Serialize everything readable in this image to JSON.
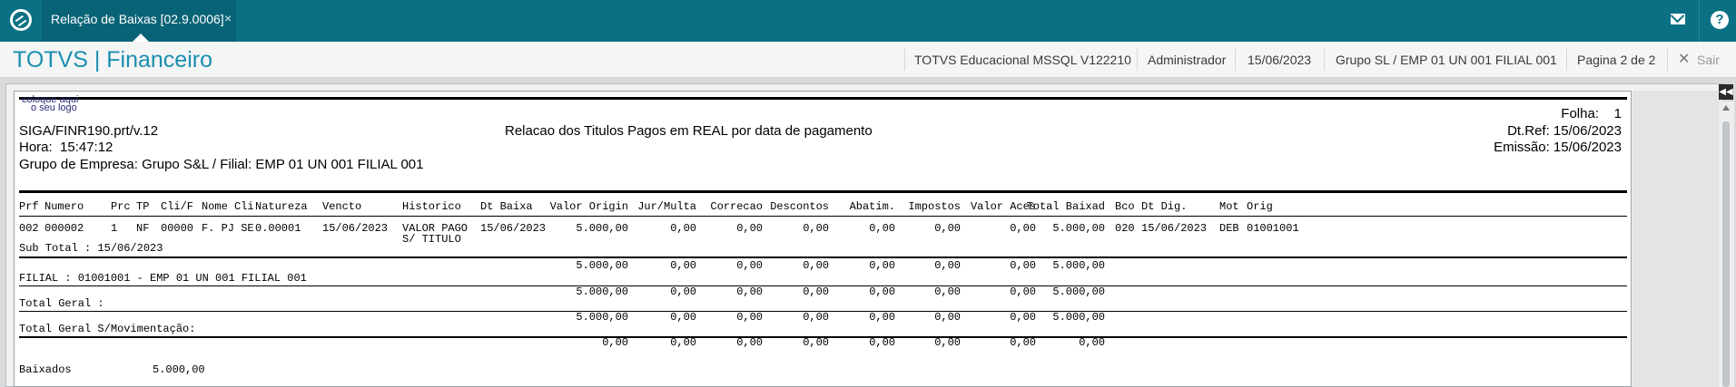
{
  "topbar": {
    "tab_title": "Relação de Baixas [02.9.0006]",
    "tab_close": "×",
    "help_symbol": "?"
  },
  "header": {
    "brand": "TOTVS | Financeiro",
    "environment": "TOTVS Educacional MSSQL V122210",
    "user": "Administrador",
    "date": "15/06/2023",
    "group": "Grupo SL / EMP 01 UN 001 FILIAL 001",
    "page": "Pagina 2 de 2",
    "exit_icon": "✕",
    "exit": "Sair"
  },
  "panel": {
    "collapse": "◀◀"
  },
  "report": {
    "logo_line1": "coloque aqui",
    "logo_line2": "o seu logo",
    "folha": "Folha:    1",
    "program": "SIGA/FINR190.prt/v.12",
    "title": "Relacao dos Titulos Pagos em REAL por data de pagamento",
    "dtref": "Dt.Ref: 15/06/2023",
    "hora": "Hora:  15:47:12",
    "emissao": "Emissão: 15/06/2023",
    "grupo": "Grupo de Empresa: Grupo S&L / Filial: EMP 01 UN 001 FILIAL 001",
    "columns": {
      "prf": "Prf",
      "numero": "Numero",
      "prc": "Prc",
      "tp": "TP",
      "clif": "Cli/F",
      "nomecli": "Nome Cli",
      "natureza": "Natureza",
      "vencto": "Vencto",
      "historico": "Historico",
      "dtbaixa": "Dt Baixa",
      "valororig": "Valor Origin",
      "jurmulta": "Jur/Multa",
      "correcao": "Correcao",
      "descontos": "Descontos",
      "abatim": "Abatim.",
      "impostos": "Impostos",
      "valoraces": "Valor Aces",
      "totalbaixad": "Total Baixad",
      "bco": "Bco",
      "dtdig": "Dt Dig.",
      "mot": "Mot",
      "orig": "Orig"
    },
    "row": {
      "prf": "002",
      "numero": "000002",
      "prc": "1",
      "tp": "NF",
      "clif": "00000",
      "nomecli": "F. PJ SE",
      "natureza": "0.00001",
      "vencto": "15/06/2023",
      "historico1": "VALOR PAGO",
      "historico2": "S/ TITULO",
      "dtbaixa": "15/06/2023",
      "valororig": "5.000,00",
      "jurmulta": "0,00",
      "correcao": "0,00",
      "descontos": "0,00",
      "abatim": "0,00",
      "impostos": "0,00",
      "valoraces": "0,00",
      "totalbaixad": "5.000,00",
      "bco": "020",
      "dtdig": "15/06/2023",
      "mot": "DEB",
      "orig": "01001001"
    },
    "subtotal_label": "Sub Total : 15/06/2023",
    "filial_label": "FILIAL : 01001001 - EMP 01 UN 001 FILIAL 001",
    "totalgeral_label": "Total Geral :",
    "totalgeral_semmov_label": "Total Geral S/Movimentação:",
    "totals": {
      "sub": [
        "5.000,00",
        "0,00",
        "0,00",
        "0,00",
        "0,00",
        "0,00",
        "0,00",
        "5.000,00"
      ],
      "filial": [
        "5.000,00",
        "0,00",
        "0,00",
        "0,00",
        "0,00",
        "0,00",
        "0,00",
        "5.000,00"
      ],
      "geral": [
        "5.000,00",
        "0,00",
        "0,00",
        "0,00",
        "0,00",
        "0,00",
        "0,00",
        "5.000,00"
      ],
      "semmov": [
        "0,00",
        "0,00",
        "0,00",
        "0,00",
        "0,00",
        "0,00",
        "0,00",
        "0,00"
      ]
    },
    "baixados_label": "Baixados",
    "baixados_value": "5.000,00"
  }
}
